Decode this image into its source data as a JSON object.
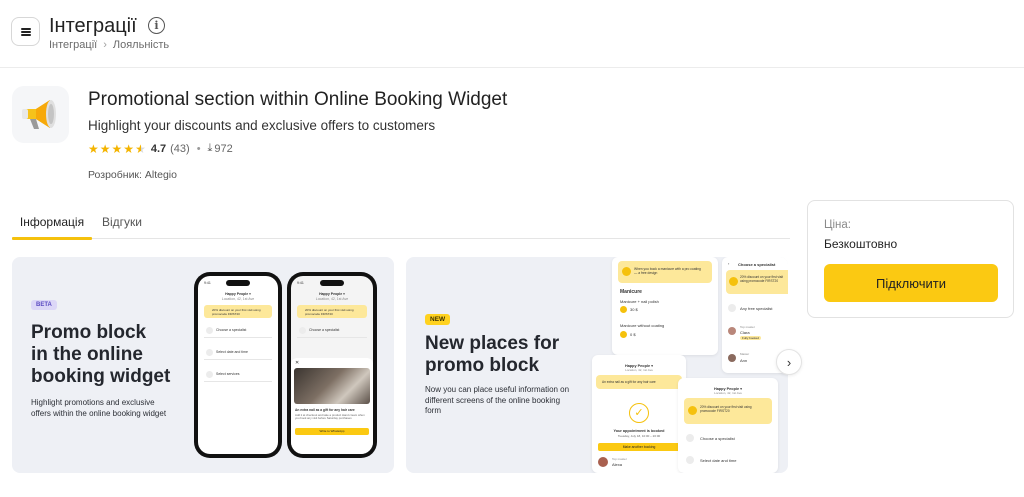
{
  "header": {
    "title": "Інтеграції",
    "breadcrumb": [
      "Інтеграції",
      "Лояльність"
    ]
  },
  "app": {
    "icon": "megaphone-icon",
    "title": "Promotional section within Online Booking Widget",
    "subtitle": "Highlight your discounts and exclusive offers to customers",
    "rating": "4.7",
    "rating_stars": 4.5,
    "reviews_count": "(43)",
    "downloads": "972",
    "developer": "Розробник: Altegio"
  },
  "tabs": [
    {
      "label": "Інформація",
      "active": true
    },
    {
      "label": "Відгуки",
      "active": false
    }
  ],
  "price_card": {
    "label": "Ціна:",
    "value": "Безкоштовно",
    "button": "Підключити"
  },
  "banners": [
    {
      "badge": "BETA",
      "title_lines": [
        "Promo block",
        "in the online",
        "booking widget"
      ],
      "desc_lines": [
        "Highlight promotions and exclusive",
        "offers within the online booking widget"
      ],
      "phone_left": {
        "time": "9:41",
        "header": "Happy People ▾",
        "subheader": "Location, 42, 1st Ave",
        "promo": "20% discount on your first visit using promocode FIRST20",
        "rows": [
          "Choose a specialist",
          "Select date and time",
          "Select services"
        ]
      },
      "phone_right": {
        "time": "9:41",
        "header": "Happy People ▾",
        "subheader": "Location, 42, 1st Ave",
        "promo": "20% discount on your first visit using promocode FIRST20",
        "row": "Choose a specialist",
        "modal_title": "An extra nail as a gift for any hair care",
        "modal_text": "Add it at checkout and take a product Hand cream when you book any visit before Saturday purchases",
        "modal_button": "Write to WhatsApp"
      }
    },
    {
      "badge": "NEW",
      "title_lines": [
        "New places for",
        "promo block"
      ],
      "desc_lines": [
        "Now you can place useful information on",
        "different screens of the online booking",
        "form"
      ],
      "mock": {
        "top_promo": "When you book a manicure with a pro coating — a free design",
        "services_title": "Manicure",
        "service1": "Manicure + nail polish",
        "price1": "30 $",
        "service2": "Manicure without coating",
        "price2": "0 $",
        "specialist_title": "Choose a specialist",
        "spec_promo": "20% discount on your first visit using promocode FIRST20",
        "spec_any": "Any free specialist",
        "spec1_role": "Top master",
        "spec1_name": "Clara",
        "spec1_badge": "Fully booked",
        "spec2_role": "Master",
        "spec2_name": "Ann",
        "card2_header": "Happy People ▾",
        "card2_sub": "Location, 42, 1st Ave",
        "card2_promo": "An extra nail as a gift for any hair care",
        "confirm_title": "Your appointment is booked",
        "confirm_date": "Tuesday, July 18, 10:00 – 20:00",
        "confirm_button": "Make another booking",
        "master_label": "Top master",
        "master_name": "Alexa",
        "card3_header": "Happy People ▾",
        "card3_sub": "Location, 42, 1st Ave",
        "card3_promo": "20% discount on your first visit using promocode FIRST20",
        "card3_row1": "Choose a specialist",
        "card3_row2": "Select date and time"
      }
    }
  ],
  "colors": {
    "accent": "#fbc912",
    "tab_underline": "#f5c10d",
    "star": "#f4b400",
    "banner_bg": "#eef0f5",
    "promo_bg": "#fde89a"
  }
}
